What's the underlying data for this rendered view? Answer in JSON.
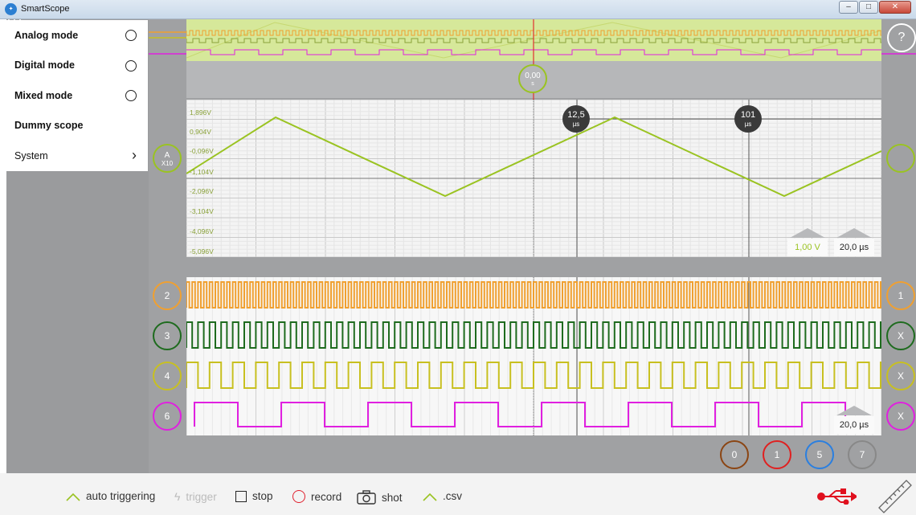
{
  "window": {
    "title": "SmartScope",
    "app_icon": "smartscope-icon"
  },
  "menu": {
    "items": [
      {
        "label": "Analog mode",
        "control": "radio"
      },
      {
        "label": "Digital mode",
        "control": "radio"
      },
      {
        "label": "Mixed mode",
        "control": "radio"
      },
      {
        "label": "Dummy scope",
        "control": "none"
      },
      {
        "label": "System",
        "control": "chevron"
      }
    ]
  },
  "scope": {
    "trigger_time": {
      "value": "0,00",
      "unit": "s"
    },
    "analog_channel": {
      "label": "A",
      "probe": "X10",
      "color": "#9ac321"
    },
    "y_labels": [
      "1,896V",
      "0,904V",
      "-0,096V",
      "-1,104V",
      "-2,096V",
      "-3,104V",
      "-4,096V",
      "-5,096V"
    ],
    "cursors": [
      {
        "value": "12,5",
        "unit": "µs"
      },
      {
        "value": "101",
        "unit": "µs"
      }
    ],
    "analog_volt_div": "1,00 V",
    "analog_time_div": "20,0 µs",
    "digital_time_div": "20,0 µs",
    "help_label": "?",
    "right_analog_label": "",
    "digital_left_channels": [
      {
        "label": "2",
        "color": "#f0a030"
      },
      {
        "label": "3",
        "color": "#1e6b1e"
      },
      {
        "label": "4",
        "color": "#c8c020"
      },
      {
        "label": "6",
        "color": "#e020e0"
      }
    ],
    "digital_right_channels": [
      {
        "label": "1",
        "color": "#f0a030"
      },
      {
        "label": "X",
        "color": "#1e6b1e"
      },
      {
        "label": "X",
        "color": "#c8c020"
      },
      {
        "label": "X",
        "color": "#e020e0"
      }
    ],
    "hidden_channels": [
      {
        "label": "0",
        "color": "#8b4513"
      },
      {
        "label": "1",
        "color": "#e02020"
      },
      {
        "label": "5",
        "color": "#2a7fe0"
      },
      {
        "label": "7",
        "color": "#888888"
      }
    ]
  },
  "toolbar": {
    "auto_triggering": "auto triggering",
    "trigger": "trigger",
    "stop": "stop",
    "record": "record",
    "shot": "shot",
    "csv": ".csv"
  }
}
